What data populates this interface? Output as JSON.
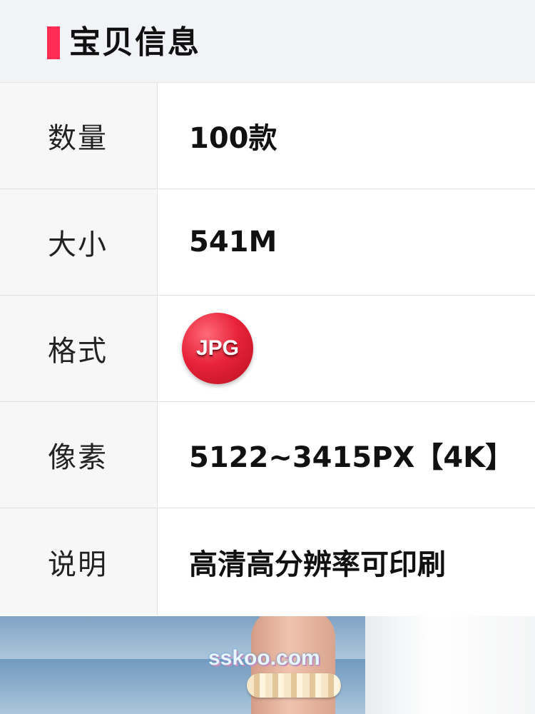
{
  "header": {
    "title": "宝贝信息",
    "accent_color": "#ff2d55"
  },
  "rows": [
    {
      "label": "数量",
      "value": "100款"
    },
    {
      "label": "大小",
      "value": "541M"
    },
    {
      "label": "格式",
      "badge": "JPG"
    },
    {
      "label": "像素",
      "value": "5122~3415PX【4K】"
    },
    {
      "label": "说明",
      "value": "高清高分辨率可印刷"
    }
  ],
  "photo": {
    "watermark": "sskoo.com"
  }
}
